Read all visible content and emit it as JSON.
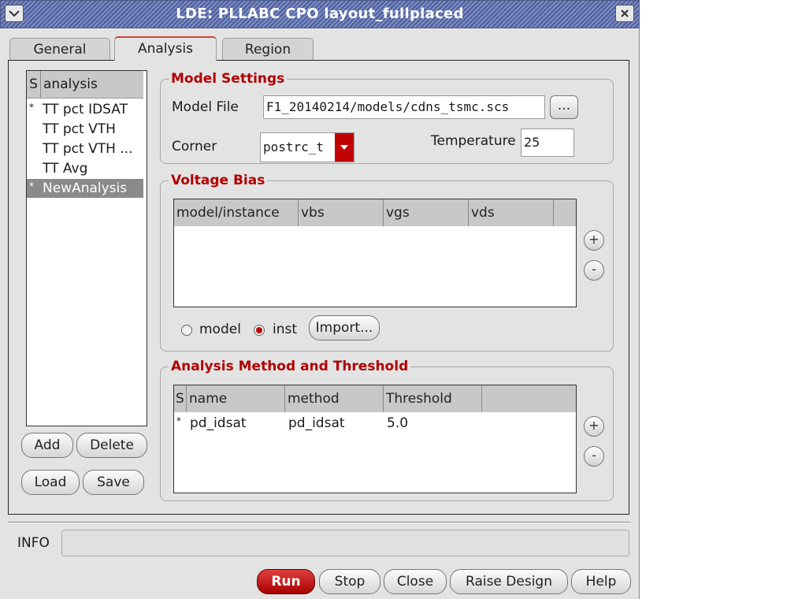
{
  "window": {
    "title": "LDE: PLLABC CPO layout_fullplaced"
  },
  "tabs": [
    {
      "label": "General"
    },
    {
      "label": "Analysis"
    },
    {
      "label": "Region"
    }
  ],
  "analysis_list": {
    "header_s": "S",
    "header_name": "analysis",
    "items": [
      {
        "star": "*",
        "label": "TT pct IDSAT"
      },
      {
        "star": "",
        "label": "TT pct VTH"
      },
      {
        "star": "",
        "label": "TT pct VTH ..."
      },
      {
        "star": "",
        "label": "TT Avg"
      },
      {
        "star": "*",
        "label": "NewAnalysis"
      }
    ],
    "add_label": "Add",
    "delete_label": "Delete",
    "load_label": "Load",
    "save_label": "Save"
  },
  "model_settings": {
    "title": "Model Settings",
    "model_file_label": "Model File",
    "model_file_value": "F1_20140214/models/cdns_tsmc.scs",
    "browse_label": "...",
    "corner_label": "Corner",
    "corner_value": "postrc_t",
    "temperature_label": "Temperature",
    "temperature_value": "25"
  },
  "voltage_bias": {
    "title": "Voltage Bias",
    "columns": [
      "model/instance",
      "vbs",
      "vgs",
      "vds"
    ],
    "radio_model_label": "model",
    "radio_inst_label": "inst",
    "selected": "inst",
    "import_label": "Import...",
    "add_row": "+",
    "remove_row": "-"
  },
  "analysis_method": {
    "title": "Analysis Method and Threshold",
    "columns": [
      "S",
      "name",
      "method",
      "Threshold"
    ],
    "rows": [
      {
        "s": "*",
        "name": "pd_idsat",
        "method": "pd_idsat",
        "threshold": "5.0"
      }
    ],
    "add_row": "+",
    "remove_row": "-"
  },
  "info": {
    "label": "INFO",
    "value": ""
  },
  "footer": {
    "run": "Run",
    "stop": "Stop",
    "close": "Close",
    "raise": "Raise Design",
    "help": "Help"
  },
  "colors": {
    "accent_red": "#b00000",
    "title_bar": "#5f6fa8"
  }
}
